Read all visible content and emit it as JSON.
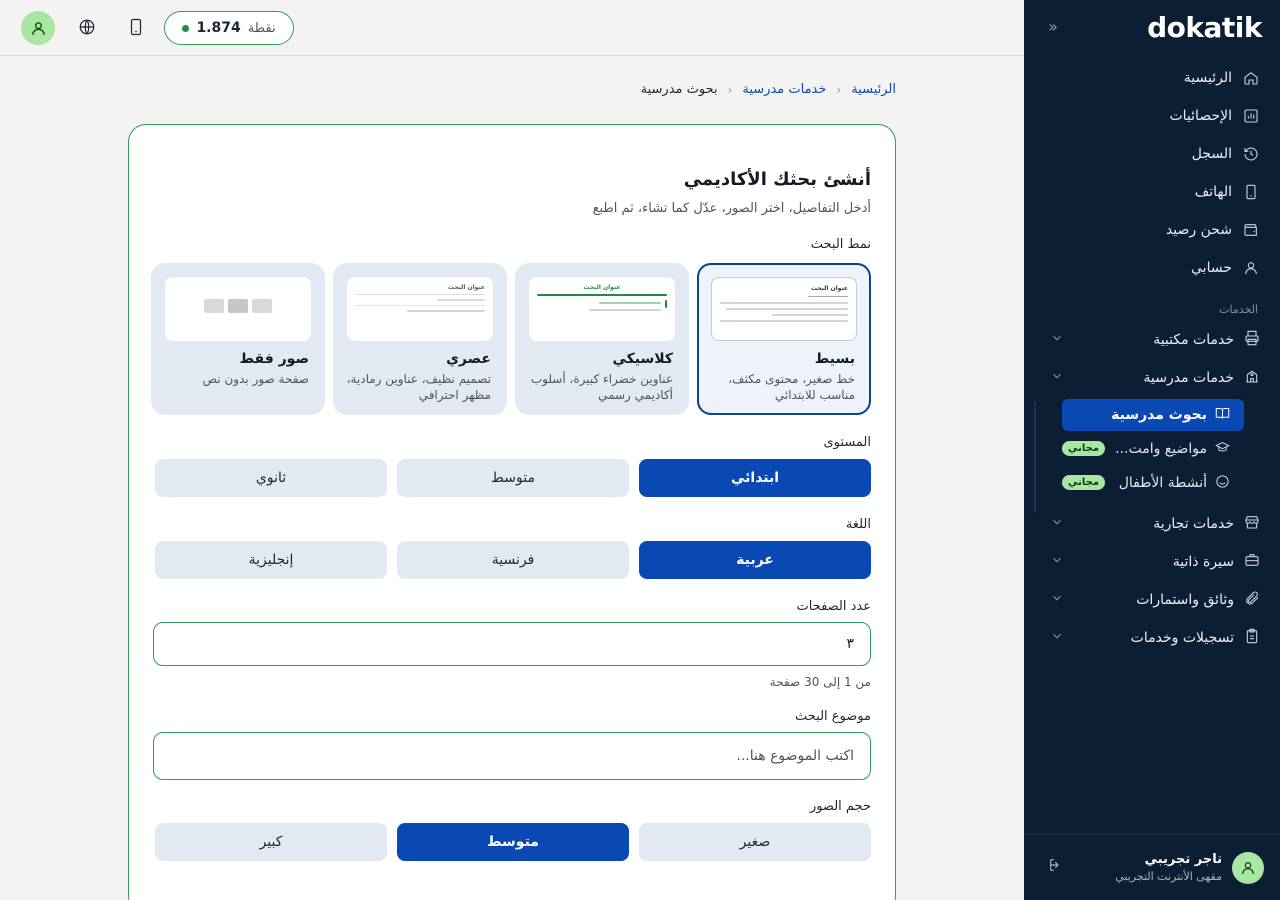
{
  "topbar": {
    "points_value": "1.874",
    "points_unit": "نقطة",
    "avatar_icon": "user-icon",
    "language_icon": "globe-icon",
    "device_icon": "phone-icon"
  },
  "sidebar": {
    "logo": "dokatik",
    "main_items": [
      {
        "label": "الرئيسية",
        "icon": "home-icon"
      },
      {
        "label": "الإحصائيات",
        "icon": "chart-icon"
      },
      {
        "label": "السجل",
        "icon": "history-icon"
      },
      {
        "label": "الهاتف",
        "icon": "phone-icon"
      },
      {
        "label": "شحن رصيد",
        "icon": "wallet-icon"
      },
      {
        "label": "حسابي",
        "icon": "user-icon"
      }
    ],
    "section_label": "الخدمات",
    "groups": [
      {
        "label": "خدمات مكتبية",
        "icon": "printer-icon"
      },
      {
        "label": "خدمات مدرسية",
        "icon": "school-icon"
      },
      {
        "label": "خدمات تجارية",
        "icon": "store-icon"
      },
      {
        "label": "سيرة ذاتية",
        "icon": "briefcase-icon"
      },
      {
        "label": "وثائق واستمارات",
        "icon": "paperclip-icon"
      },
      {
        "label": "تسجيلات وخدمات",
        "icon": "clipboard-icon"
      }
    ],
    "sub_items": [
      {
        "label": "بحوث مدرسية",
        "icon": "book-icon",
        "active": true
      },
      {
        "label": "مواضيع وامت...",
        "icon": "graduation-icon",
        "badge": "مجاني"
      },
      {
        "label": "أنشطة الأطفال",
        "icon": "smile-icon",
        "badge": "مجاني"
      }
    ],
    "user": {
      "name": "تاجر تجريبي",
      "subtitle": "مقهى الأنترنت التجريبي"
    }
  },
  "breadcrumb": {
    "home": "الرئيسية",
    "section": "خدمات مدرسية",
    "current": "بحوث مدرسية"
  },
  "form": {
    "title": "أنشئ بحثك الأكاديمي",
    "subtitle": "أدخل التفاصيل، اختر الصور، عدّل كما تشاء، ثم اطبع",
    "style_label": "نمط البحث",
    "styles": [
      {
        "name": "بسيط",
        "desc": "خط صغير، محتوى مكثف، مناسب للابتدائي",
        "preview_title": "عنوان البحث",
        "selected": true
      },
      {
        "name": "كلاسيكي",
        "desc": "عناوين خضراء كبيرة، أسلوب أكاديمي رسمي",
        "preview_title": "عنوان البحث",
        "selected": false
      },
      {
        "name": "عصري",
        "desc": "تصميم نظيف، عناوين رمادية، مظهر احترافي",
        "preview_title": "عنوان البحث",
        "selected": false
      },
      {
        "name": "صور فقط",
        "desc": "صفحة صور بدون نص",
        "selected": false
      }
    ],
    "level_label": "المستوى",
    "levels": [
      {
        "label": "ابتدائي",
        "active": true
      },
      {
        "label": "متوسط",
        "active": false
      },
      {
        "label": "ثانوي",
        "active": false
      }
    ],
    "language_label": "اللغة",
    "languages": [
      {
        "label": "عربية",
        "active": true
      },
      {
        "label": "فرنسية",
        "active": false
      },
      {
        "label": "إنجليزية",
        "active": false
      }
    ],
    "pages_label": "عدد الصفحات",
    "pages_value": "٣",
    "pages_hint": "من 1 إلى 30 صفحة",
    "topic_label": "موضوع البحث",
    "topic_placeholder": "اكتب الموضوع هنا...",
    "image_size_label": "حجم الصور",
    "image_sizes": [
      {
        "label": "صغير",
        "active": false
      },
      {
        "label": "متوسط",
        "active": true
      },
      {
        "label": "كبير",
        "active": false
      }
    ]
  },
  "colors": {
    "sidebar_bg": "#0c1e33",
    "primary_blue": "#0a49b3",
    "accent_green": "#2e9e5b",
    "badge_green": "#a8e6a1"
  }
}
